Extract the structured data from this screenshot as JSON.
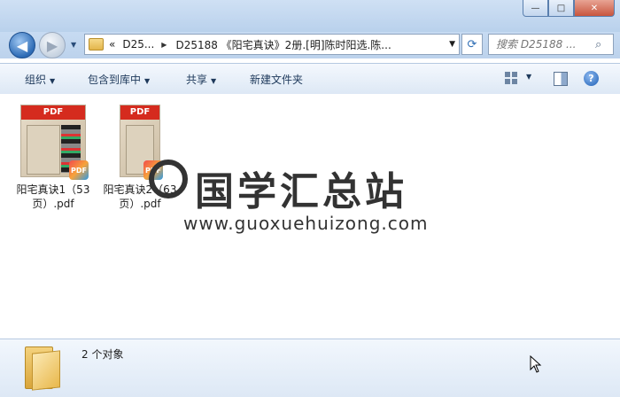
{
  "address": {
    "back_label": "◀",
    "forward_label": "▶",
    "crumb_overflow": "«",
    "crumb1": "D25...",
    "crumb2": "D25188 《阳宅真诀》2册.[明]陈时阳选.陈..."
  },
  "search": {
    "placeholder": "搜索 D25188 ..."
  },
  "toolbar": {
    "organize": "组织",
    "include_library": "包含到库中",
    "share": "共享",
    "new_folder": "新建文件夹",
    "help": "?"
  },
  "files": [
    {
      "name": "阳宅真诀1（53页）.pdf",
      "line1": "阳宅真诀1（53",
      "line2": "页）.pdf",
      "badge": "PDF"
    },
    {
      "name": "阳宅真诀2（63页）.pdf",
      "line1": "阳宅真诀2（63",
      "line2": "页）.pdf",
      "badge": "PDF"
    }
  ],
  "watermark": {
    "title": "国学汇总站",
    "url": "www.guoxuehuizong.com"
  },
  "status": {
    "count": "2 个对象"
  },
  "window": {
    "min": "—",
    "max": "□",
    "close": "✕"
  },
  "colors": {
    "toolbar_text": "#1e395b",
    "pdf_red": "#d52b1e",
    "title_bar": "#c7dbf2"
  }
}
